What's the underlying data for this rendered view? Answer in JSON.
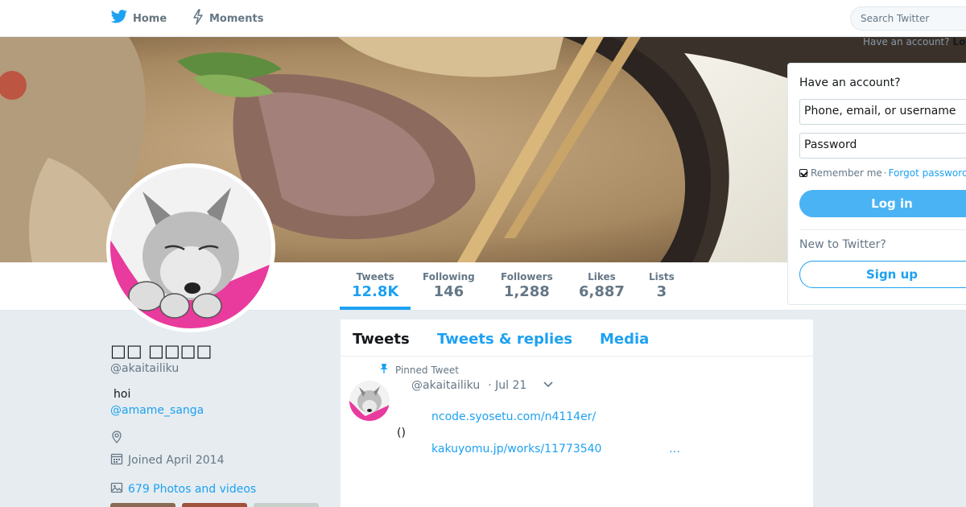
{
  "nav": {
    "home_label": "Home",
    "moments_label": "Moments",
    "search_placeholder": "Search Twitter",
    "have_account_small": "Have an account?",
    "login_small": "Lo"
  },
  "profile": {
    "name": "□□ □□□□",
    "handle": "@akaitailiku",
    "bio": "hoi",
    "bio_link": "@amame_sanga",
    "joined": "Joined April 2014",
    "photos": "679 Photos and videos"
  },
  "stats": [
    {
      "label": "Tweets",
      "value": "12.8K"
    },
    {
      "label": "Following",
      "value": "146"
    },
    {
      "label": "Followers",
      "value": "1,288"
    },
    {
      "label": "Likes",
      "value": "6,887"
    },
    {
      "label": "Lists",
      "value": "3"
    }
  ],
  "tabs": [
    "Tweets",
    "Tweets & replies",
    "Media"
  ],
  "tweet": {
    "pinned_label": "Pinned Tweet",
    "handle": "@akaitailiku",
    "date": "· Jul 21",
    "link1": "ncode.syosetu.com/n4114er/",
    "paren": "()",
    "link2": "kakuyomu.jp/works/11773540",
    "ellipsis": "…"
  },
  "login": {
    "heading": "Have an account?",
    "user_placeholder": "Phone, email, or username",
    "password_placeholder": "Password",
    "remember": "Remember me",
    "separator": "·",
    "forgot": "Forgot password?",
    "login_button": "Log in",
    "new_heading": "New to Twitter?",
    "signup_button": "Sign up"
  },
  "colors": {
    "accent": "#1da1f2",
    "page_bg": "#e6ecf0",
    "login_button": "#4ab3f4"
  }
}
